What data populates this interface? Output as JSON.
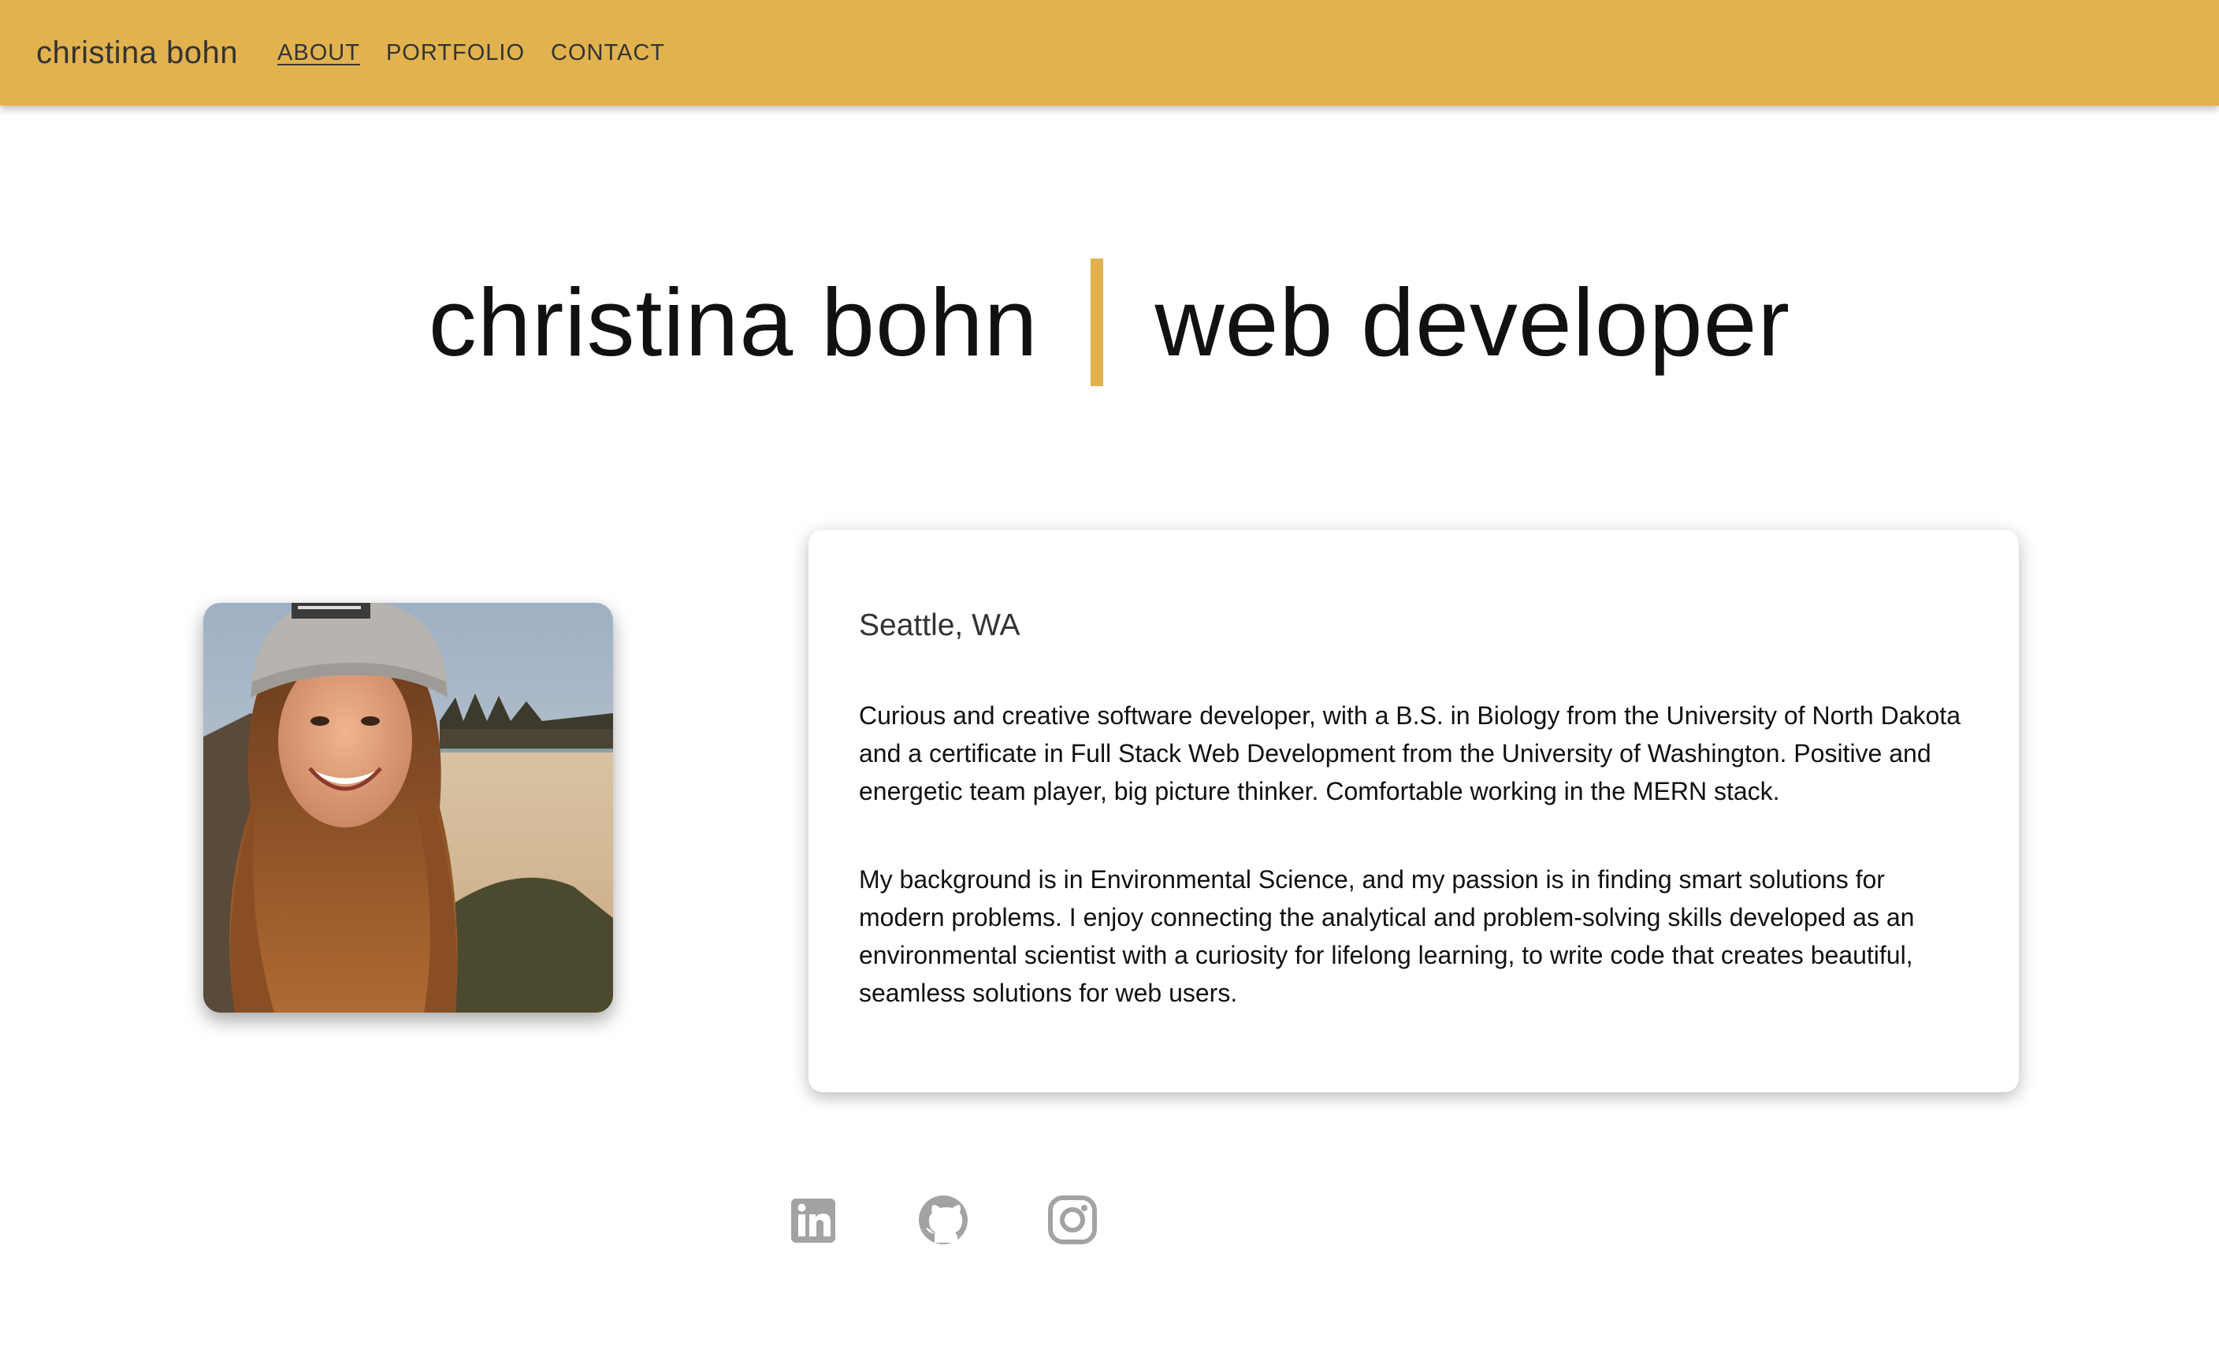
{
  "nav": {
    "brand": "christina bohn",
    "links": [
      "ABOUT",
      "PORTFOLIO",
      "CONTACT"
    ],
    "active": "ABOUT"
  },
  "hero": {
    "name": "christina bohn",
    "role": "web developer"
  },
  "about": {
    "location": "Seattle, WA",
    "paragraphs": [
      "Curious and creative software developer, with a B.S. in Biology from the University of North Dakota and a certificate in Full Stack Web Development from the University of Washington. Positive and energetic team player, big picture thinker. Comfortable working in the MERN stack.",
      "My background is in Environmental Science, and my passion is in finding smart solutions for modern problems. I enjoy connecting the analytical and problem-solving skills developed as an environmental scientist with a curiosity for lifelong learning, to write code that creates beautiful, seamless solutions for web users."
    ]
  },
  "social": [
    "linkedin-icon",
    "github-icon",
    "instagram-icon"
  ],
  "colors": {
    "accent": "#e1b24e",
    "icon": "#a3a3a3"
  }
}
